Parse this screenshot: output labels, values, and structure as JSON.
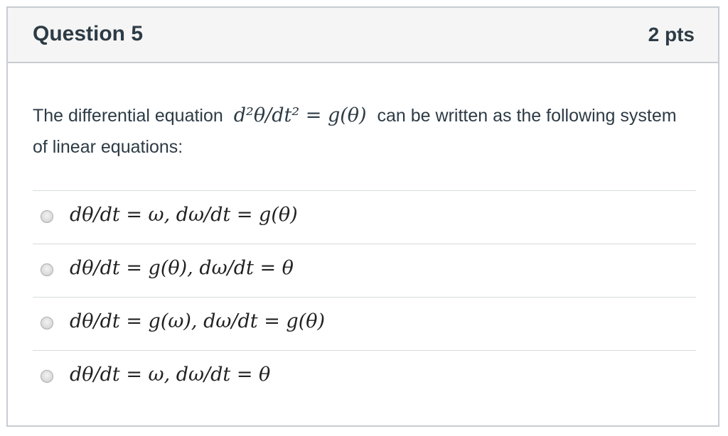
{
  "question": {
    "title": "Question 5",
    "points": "2 pts",
    "text_before": "The differential equation",
    "equation": "d²θ/dt² = g(θ)",
    "text_after": "can be written as the following system of linear equations:"
  },
  "answers": [
    {
      "label": "dθ/dt = ω, dω/dt = g(θ)",
      "selected": false
    },
    {
      "label": "dθ/dt = g(θ), dω/dt = θ",
      "selected": false
    },
    {
      "label": "dθ/dt = g(ω), dω/dt = g(θ)",
      "selected": false
    },
    {
      "label": "dθ/dt = ω, dω/dt = θ",
      "selected": false
    }
  ],
  "colors": {
    "header_background": "#f5f5f5",
    "border": "#c7cdd1",
    "text": "#2d3b45",
    "divider": "#d6dadd"
  }
}
